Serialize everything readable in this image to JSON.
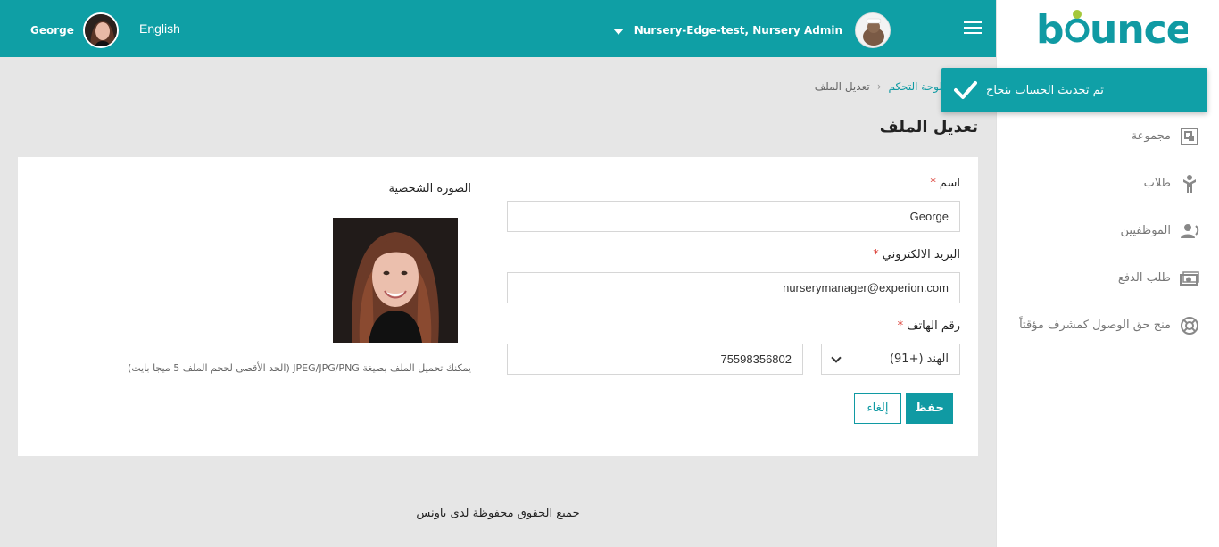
{
  "header": {
    "user_name": "George",
    "language": "English",
    "nursery_label": "Nursery-Edge-test, Nursery Admin"
  },
  "sidebar": {
    "logo": "bounce",
    "items": [
      {
        "label": "مجموعة",
        "icon": "group-icon"
      },
      {
        "label": "طلاب",
        "icon": "student-icon"
      },
      {
        "label": "الموظفيين",
        "icon": "staff-icon"
      },
      {
        "label": "طلب الدفع",
        "icon": "payment-icon"
      },
      {
        "label": "منح حق الوصول كمشرف مؤقتاً",
        "icon": "lifebuoy-icon"
      }
    ]
  },
  "toast": {
    "message": "تم تحديث الحساب بنجاح"
  },
  "breadcrumb": {
    "home": "لوحة التحكم",
    "current": "تعديل الملف"
  },
  "page": {
    "title": "تعديل الملف"
  },
  "form": {
    "name_label": "اسم",
    "name_value": "George",
    "email_label": "البريد الالكتروني",
    "email_value": "nurserymanager@experion.com",
    "phone_label": "رقم الهاتف",
    "country_value": "الهند (+91)",
    "phone_value": "75598356802",
    "save_label": "حفظ",
    "cancel_label": "إلغاء",
    "required_mark": "*"
  },
  "profile": {
    "label": "الصورة الشخصية",
    "hint": "يمكنك تحميل الملف بصيغة JPEG/JPG/PNG (الحد الأقصى لحجم الملف 5 ميجا بايت)"
  },
  "footer": {
    "text": "جميع الحقوق محفوظة لدى باونس"
  },
  "colors": {
    "primary": "#0f9fa5",
    "accent_green": "#a5c83b",
    "required": "#d9342b"
  }
}
